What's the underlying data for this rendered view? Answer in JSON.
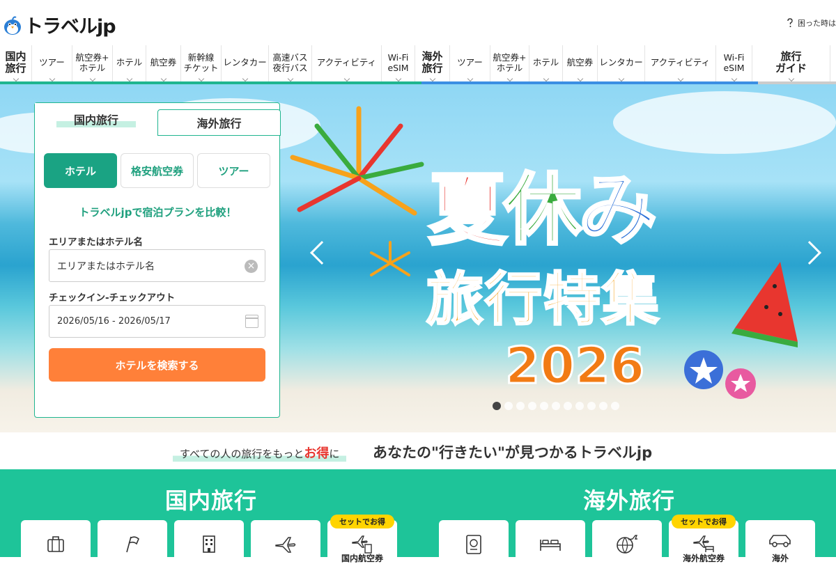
{
  "header": {
    "logo_text": "トラベルjp",
    "help_label": "困った時は"
  },
  "nav": {
    "items": [
      {
        "label": "国内\n旅行",
        "group": true
      },
      {
        "label": "ツアー"
      },
      {
        "label": "航空券+\nホテル"
      },
      {
        "label": "ホテル"
      },
      {
        "label": "航空券"
      },
      {
        "label": "新幹線\nチケット"
      },
      {
        "label": "レンタカー"
      },
      {
        "label": "高速バス\n夜行バス"
      },
      {
        "label": "アクティビティ"
      },
      {
        "label": "Wi-Fi\neSIM"
      },
      {
        "label": "海外\n旅行",
        "group": true
      },
      {
        "label": "ツアー"
      },
      {
        "label": "航空券+\nホテル"
      },
      {
        "label": "ホテル"
      },
      {
        "label": "航空券"
      },
      {
        "label": "レンタカー"
      },
      {
        "label": "アクティビティ"
      },
      {
        "label": "Wi-Fi\neSIM"
      },
      {
        "label": "旅行\nガイド",
        "group": true
      }
    ]
  },
  "hero": {
    "title_chars": [
      "夏",
      "休",
      "み"
    ],
    "title_colors": [
      "#e8362f",
      "#3aab3e",
      "#2a6fd8"
    ],
    "subtitle": "旅行特集",
    "year": "2026",
    "slide_count": 11,
    "active_slide": 1
  },
  "search_panel": {
    "tab_domestic": "国内旅行",
    "tab_overseas": "海外旅行",
    "segments": [
      "ホテル",
      "格安航空券",
      "ツアー"
    ],
    "active_segment": "ホテル",
    "compare_text": "トラベルjpで宿泊プランを比較！",
    "area_label": "エリアまたはホテル名",
    "area_placeholder": "エリアまたはホテル名",
    "date_label": "チェックイン-チェックアウト",
    "date_value": "2026/05/16 - 2026/05/17",
    "search_button": "ホテルを検索する"
  },
  "tagline": {
    "left_prefix": "すべての人の旅行をもっと",
    "left_highlight": "お得",
    "left_suffix": "に",
    "right": "あなたの\"行きたい\"が見つかるトラベルjp"
  },
  "sections": {
    "domestic_title": "国内旅行",
    "overseas_title": "海外旅行",
    "set_badge": "セットでお得",
    "domestic_card_partial": "国内航空券",
    "overseas_card_partial": "海外航空券",
    "overseas_last_partial": "海外"
  },
  "colors": {
    "brand_green": "#1fb58f",
    "overseas_blue": "#3b8fe3",
    "search_orange": "#ff8039",
    "section_green": "#1ec499",
    "badge_yellow": "#ffd400"
  }
}
